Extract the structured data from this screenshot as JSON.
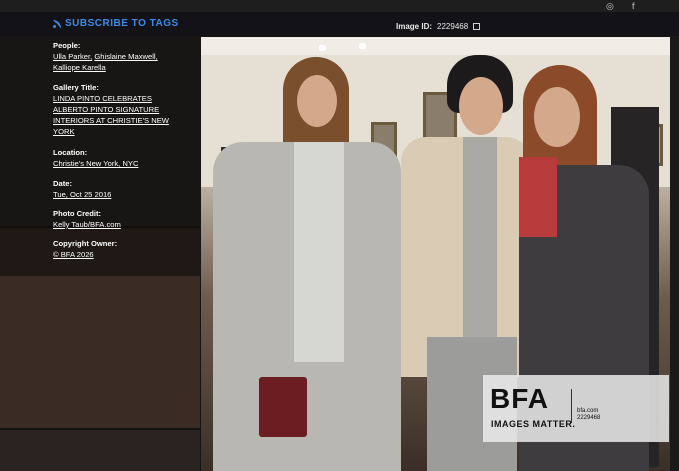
{
  "header": {
    "subscribe_label": "SUBSCRIBE TO TAGS",
    "image_id_label": "Image ID:",
    "image_id_value": "2229468"
  },
  "info": {
    "people_head": "People:",
    "people": [
      "Ulla Parker,",
      "Ghislaine Maxwell,",
      "Kalliope Karella"
    ],
    "gallery_head": "Gallery Title:",
    "gallery_lines": [
      "LINDA PINTO CELEBRATES",
      "ALBERTO PINTO SIGNATURE",
      "INTERIORS AT CHRISTIE'S NEW",
      "YORK"
    ],
    "location_head": "Location:",
    "location": "Christie's New York, NYC",
    "date_head": "Date:",
    "date": "Tue, Oct 25 2016",
    "credit_head": "Photo Credit:",
    "credit": "Kelly Taub/BFA.com",
    "copyright_head": "Copyright Owner:",
    "copyright": "© BFA 2026"
  },
  "watermark": {
    "logo": "BFA",
    "tagline": "IMAGES MATTER.",
    "site": "bfa.com",
    "id": "2229468"
  },
  "icons": [
    "rss-icon",
    "checkbox-icon",
    "facebook-icon",
    "instagram-icon"
  ]
}
